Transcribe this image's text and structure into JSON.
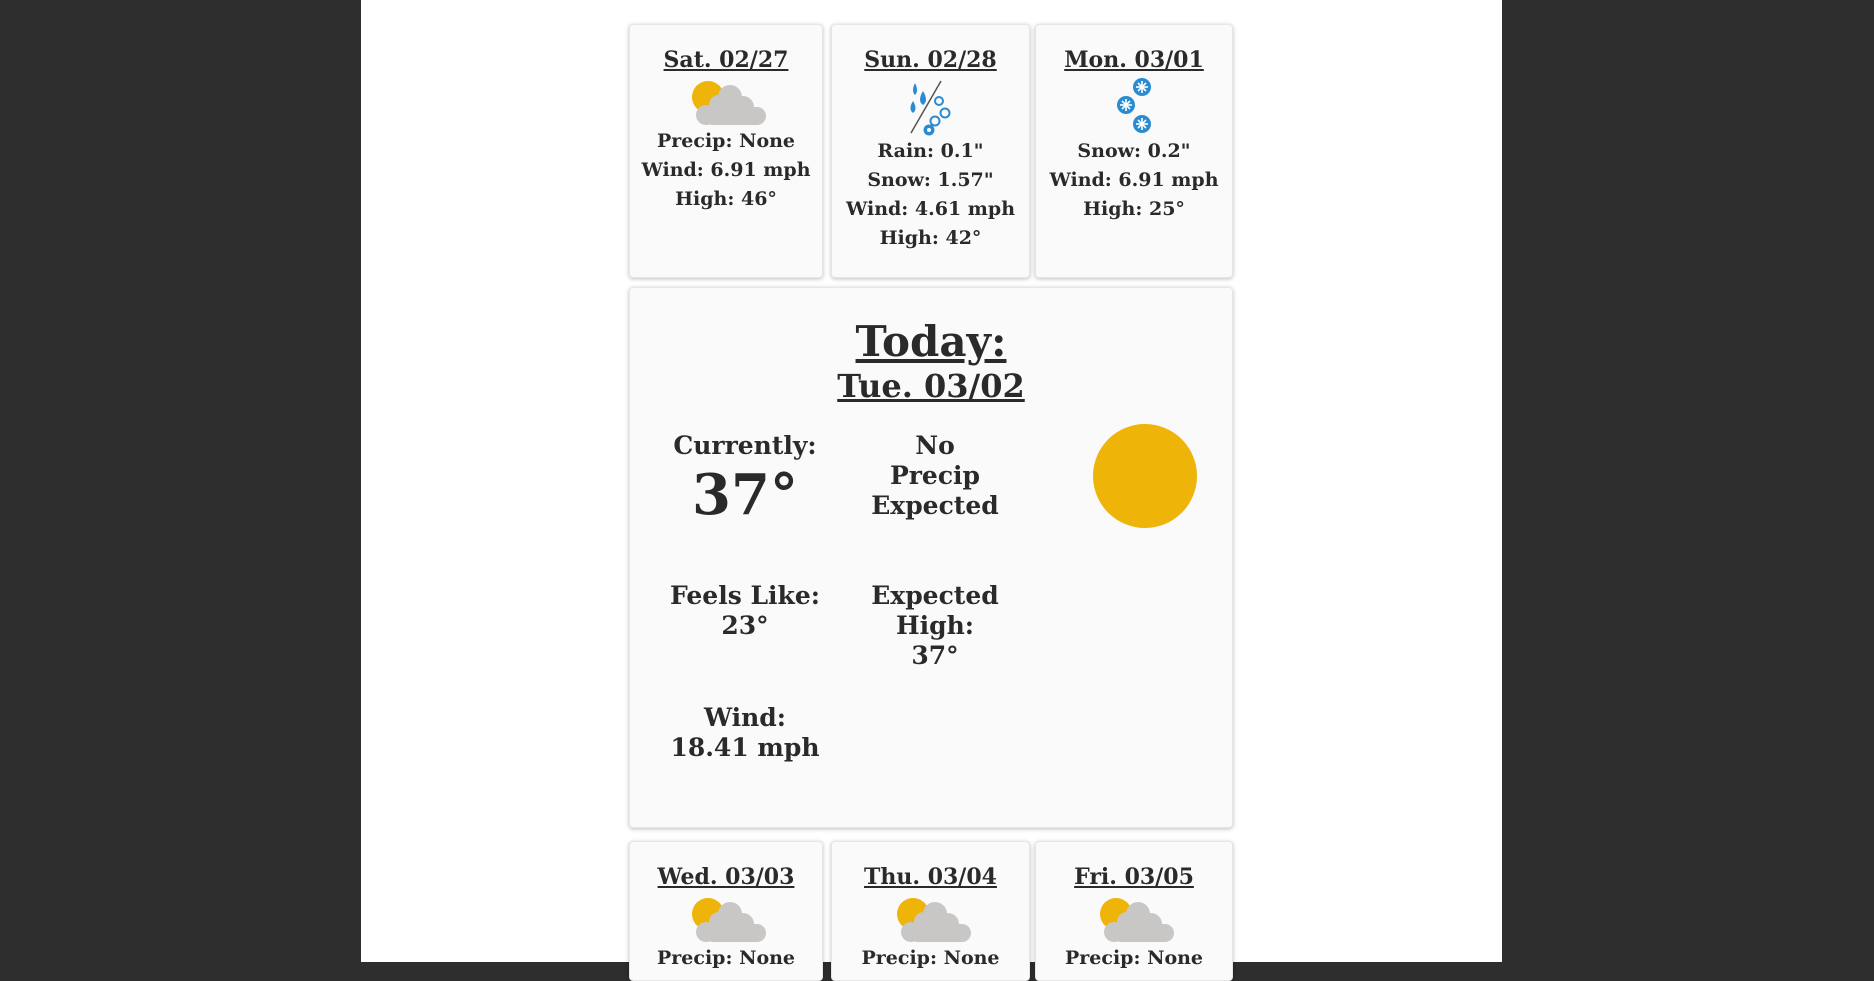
{
  "forecast_top": [
    {
      "day": "Sat. 02/27",
      "icon": "partly-cloudy-icon",
      "lines": [
        "Precip: None",
        "Wind: 6.91 mph",
        "High: 46°"
      ]
    },
    {
      "day": "Sun. 02/28",
      "icon": "rain-snow-icon",
      "lines": [
        "Rain: 0.1\"",
        "Snow: 1.57\"",
        "Wind: 4.61 mph",
        "High: 42°"
      ]
    },
    {
      "day": "Mon. 03/01",
      "icon": "snow-icon",
      "lines": [
        "Snow: 0.2\"",
        "Wind: 6.91 mph",
        "High: 25°"
      ]
    }
  ],
  "today": {
    "label": "Today:",
    "date": "Tue. 03/02",
    "currently_label": "Currently:",
    "currently_value": "37°",
    "precip_line1": "No",
    "precip_line2": "Precip",
    "precip_line3": "Expected",
    "feels_label": "Feels Like:",
    "feels_value": "23°",
    "high_line1": "Expected",
    "high_line2": "High:",
    "high_value": "37°",
    "wind_label": "Wind:",
    "wind_value": "18.41 mph",
    "icon": "sun-icon"
  },
  "forecast_bottom": [
    {
      "day": "Wed. 03/03",
      "icon": "partly-cloudy-icon",
      "lines": [
        "Precip: None"
      ]
    },
    {
      "day": "Thu. 03/04",
      "icon": "partly-cloudy-icon",
      "lines": [
        "Precip: None"
      ]
    },
    {
      "day": "Fri. 03/05",
      "icon": "partly-cloudy-icon",
      "lines": [
        "Precip: None"
      ]
    }
  ],
  "colors": {
    "sun": "#eeb408",
    "cloud": "#c9c6c6",
    "water": "#2a8bd0",
    "background": "#2e2e2e"
  }
}
